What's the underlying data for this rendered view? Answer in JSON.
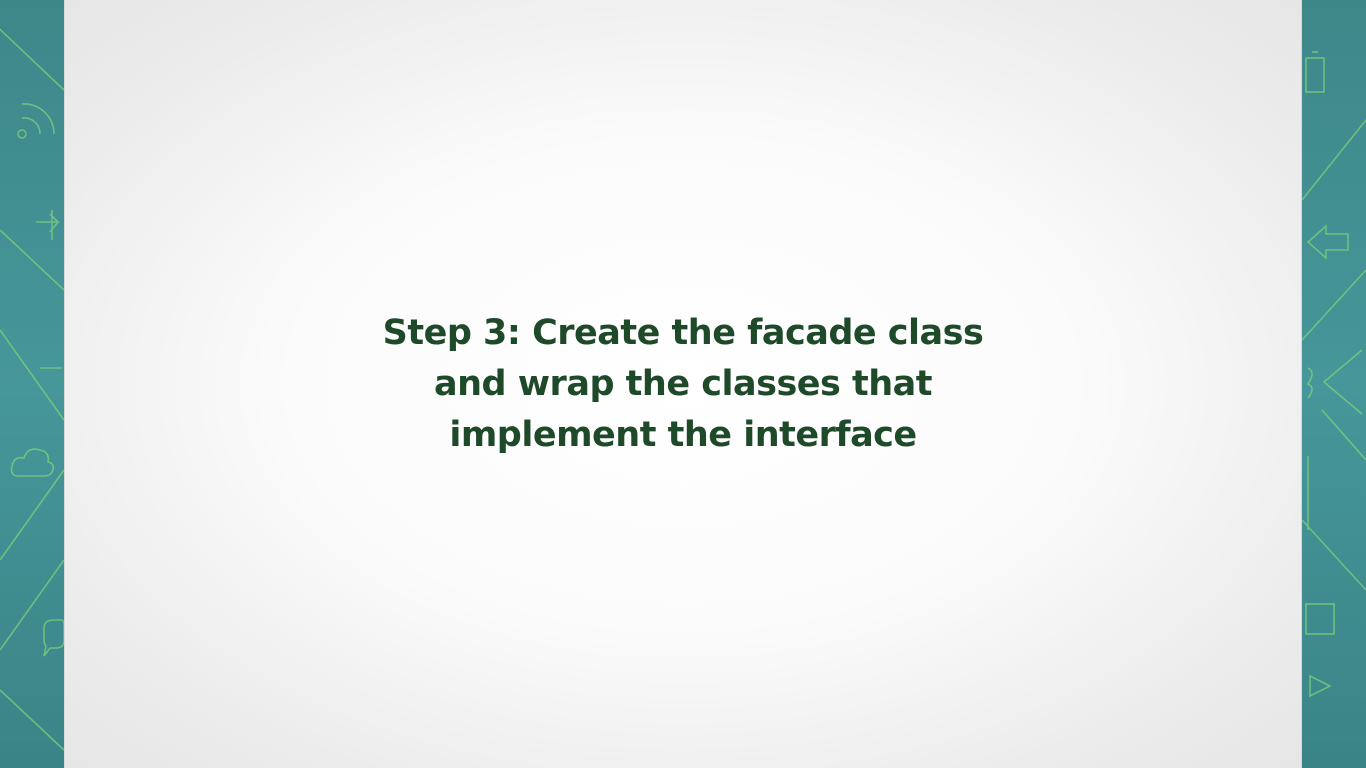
{
  "slide": {
    "lines": [
      "Step 3: Create the facade class",
      "and wrap the classes that",
      "implement the interface"
    ]
  },
  "colors": {
    "side_panel": "#3f8a8c",
    "doodle_stroke": "#7fd07a",
    "slide_background": "#ffffff",
    "title_text": "#1f4a2a"
  },
  "icons": {
    "left_panel": [
      "wifi-icon",
      "arrow-right-icon",
      "cloud-icon",
      "chat-bubble-icon"
    ],
    "right_panel": [
      "battery-icon",
      "arrow-left-icon",
      "chevron-left-icon",
      "square-icon",
      "play-icon"
    ]
  }
}
